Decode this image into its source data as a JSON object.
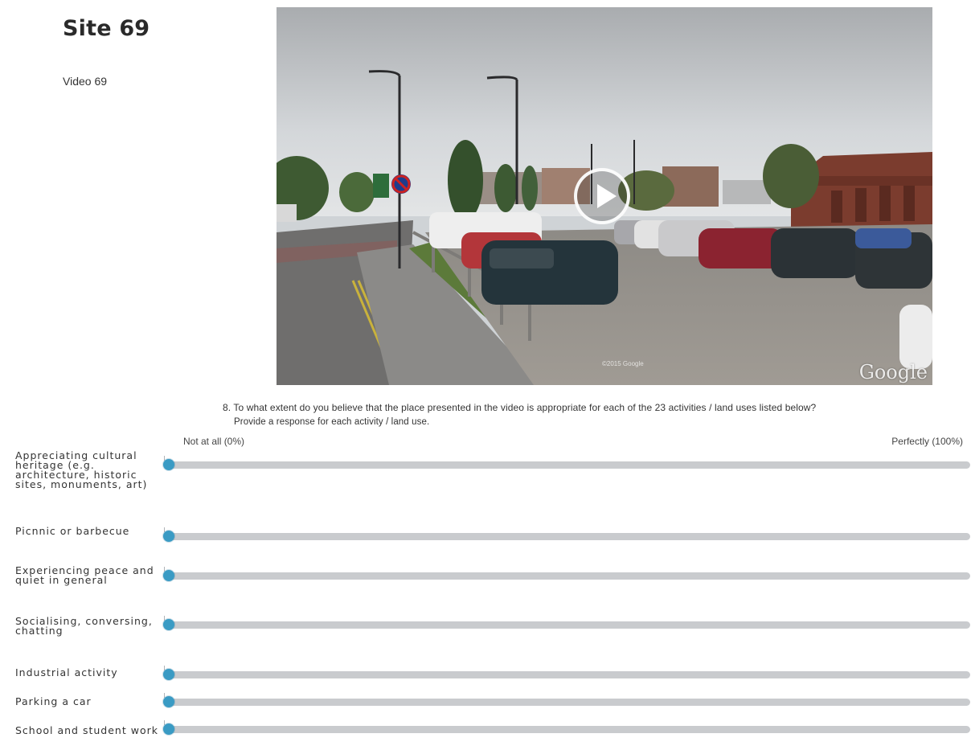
{
  "site": {
    "title": "Site 69",
    "video_label": "Video 69"
  },
  "video": {
    "watermark": "Google",
    "copyright": "©2015 Google",
    "play_icon": "play-icon"
  },
  "question": {
    "line1": "8. To what extent do you believe that the place presented in the video is appropriate for each of the 23 activities / land uses listed below?",
    "line2": "Provide a response for each activity / land use."
  },
  "scale": {
    "min_label": "Not at all (0%)",
    "max_label": "Perfectly (100%)"
  },
  "activities": [
    {
      "label": "Appreciating cultural heritage (e.g. architecture, historic sites, monuments, art)",
      "value_percent": 0
    },
    {
      "label": "Picnnic or barbecue",
      "value_percent": 0
    },
    {
      "label": "Experiencing peace and quiet in general",
      "value_percent": 0
    },
    {
      "label": "Socialising, conversing, chatting",
      "value_percent": 0
    },
    {
      "label": "Industrial activity",
      "value_percent": 0
    },
    {
      "label": "Parking a car",
      "value_percent": 0
    },
    {
      "label": "School and student work",
      "value_percent": 0
    }
  ],
  "colors": {
    "thumb": "#3a9bc4",
    "track": "#c9cbce"
  }
}
